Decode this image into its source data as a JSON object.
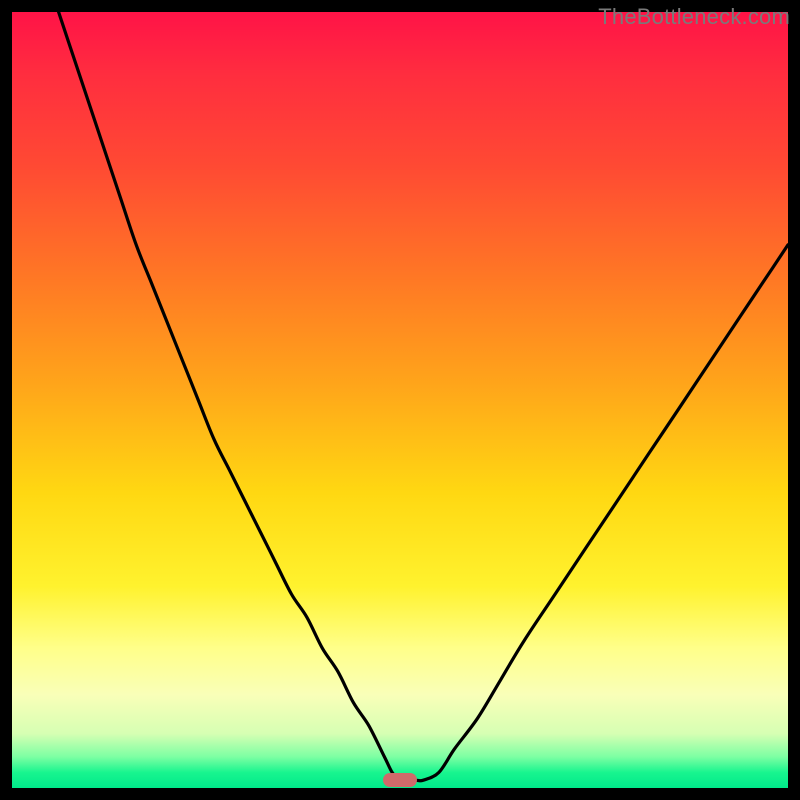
{
  "watermark": {
    "text": "TheBottleneck.com"
  },
  "colors": {
    "frame": "#000000",
    "gradient_stops": [
      "#ff1347",
      "#ff2d3f",
      "#ff4a33",
      "#ff7a24",
      "#ffa51a",
      "#ffd812",
      "#fff22e",
      "#ffff8a",
      "#f9ffb8",
      "#d6ffb3",
      "#7cffa3",
      "#18f58f",
      "#00e98a"
    ],
    "curve": "#000000",
    "marker": "#cf6a6a"
  },
  "chart_data": {
    "type": "line",
    "title": "",
    "xlabel": "",
    "ylabel": "",
    "xlim": [
      0,
      100
    ],
    "ylim": [
      0,
      100
    ],
    "grid": false,
    "legend": false,
    "x": [
      6,
      8,
      10,
      12,
      14,
      16,
      18,
      20,
      22,
      24,
      26,
      28,
      30,
      32,
      34,
      36,
      38,
      40,
      42,
      44,
      46,
      48,
      49,
      50,
      51,
      52,
      53,
      55,
      57,
      60,
      63,
      66,
      70,
      74,
      78,
      82,
      86,
      90,
      94,
      98,
      100
    ],
    "values": [
      100,
      94,
      88,
      82,
      76,
      70,
      65,
      60,
      55,
      50,
      45,
      41,
      37,
      33,
      29,
      25,
      22,
      18,
      15,
      11,
      8,
      4,
      2,
      1,
      1,
      1,
      1,
      2,
      5,
      9,
      14,
      19,
      25,
      31,
      37,
      43,
      49,
      55,
      61,
      67,
      70
    ],
    "marker": {
      "x": 50,
      "y": 1
    },
    "notes": "V-shaped bottleneck curve; minimum near x≈50; axes unlabeled; background is a red→green vertical gradient indicating severity."
  }
}
